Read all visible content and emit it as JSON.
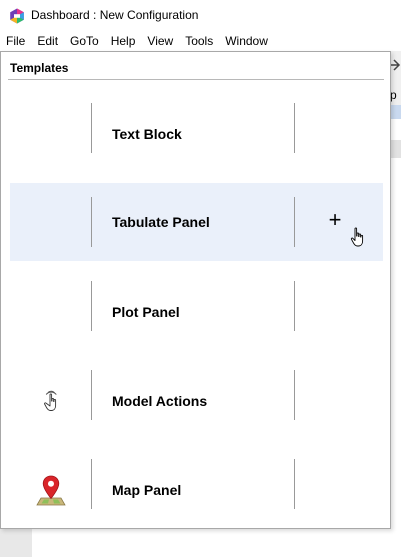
{
  "window": {
    "title": "Dashboard : New Configuration"
  },
  "menu": [
    {
      "label": "File"
    },
    {
      "label": "Edit"
    },
    {
      "label": "GoTo"
    },
    {
      "label": "Help"
    },
    {
      "label": "View"
    },
    {
      "label": "Tools"
    },
    {
      "label": "Window"
    }
  ],
  "background": {
    "tab_fragment": "p"
  },
  "popup": {
    "header": "Templates",
    "items": [
      {
        "label": "Text Block",
        "icon": ""
      },
      {
        "label": "Tabulate Panel",
        "icon": "",
        "hovered": true,
        "add_glyph": "+"
      },
      {
        "label": "Plot Panel",
        "icon": ""
      },
      {
        "label": "Model Actions",
        "icon": "hand-pointer-icon"
      },
      {
        "label": "Map Panel",
        "icon": "map-pin-icon"
      }
    ]
  },
  "colors": {
    "hover_row": "#eaf0fa",
    "separator": "#999999",
    "map_pin": "#d9252a",
    "map_base": "#c9b77a"
  }
}
